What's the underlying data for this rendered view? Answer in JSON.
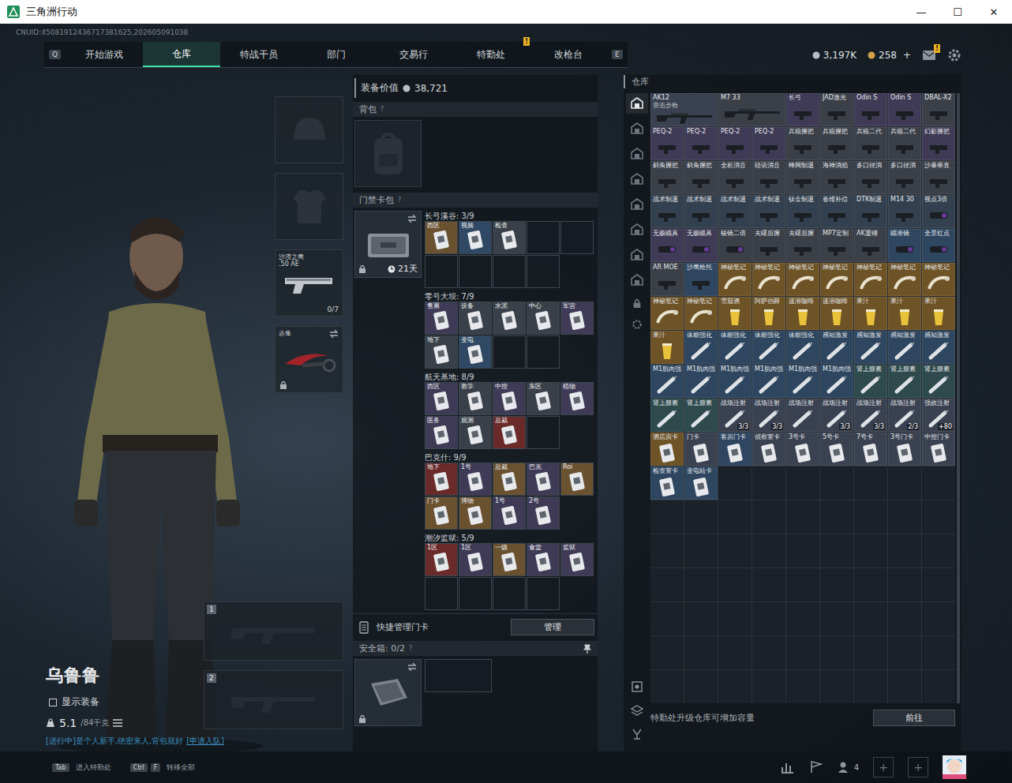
{
  "window": {
    "title": "三角洲行动",
    "controls": [
      "—",
      "☐",
      "✕"
    ]
  },
  "uid": "CNUID:45081912436717381625,202605091038",
  "nav": {
    "left_key": "Q",
    "right_key": "E",
    "tabs": [
      {
        "label": "开始游戏",
        "selected": false
      },
      {
        "label": "仓库",
        "selected": true
      },
      {
        "label": "特战干员",
        "selected": false
      },
      {
        "label": "部门",
        "selected": false
      },
      {
        "label": "交易行",
        "selected": false
      },
      {
        "label": "特勤处",
        "selected": false,
        "badge": "!"
      },
      {
        "label": "改枪台",
        "selected": false
      }
    ]
  },
  "currency": {
    "coins": "3,197K",
    "tokens": "258",
    "add": "+"
  },
  "mail": {
    "badge": "!"
  },
  "character": {
    "name": "乌鲁鲁",
    "show_gear": {
      "label": "显示装备",
      "checked": false
    },
    "weight": "5.1",
    "weight_max": "/84千克",
    "status": "[进行中]是个人新手,绝密来人,背包就好",
    "join": "[申请入队]"
  },
  "equipment": {
    "pistol": {
      "name": "沙漠之鹰",
      "caliber": ".50 AE",
      "ammo": "0/7"
    },
    "knife": {
      "name": "赤隼",
      "locked": true
    }
  },
  "weapons": [
    {
      "number": "1"
    },
    {
      "number": "2"
    }
  ],
  "loadout": {
    "value_label": "装备价值",
    "value": "38,721",
    "backpack": {
      "label": "背包",
      "help": "?"
    },
    "keycase": {
      "label": "门禁卡包",
      "help": "?",
      "days": "21天",
      "locked": true
    },
    "sections": [
      {
        "title": "长弓溪谷: 3/9",
        "cards": [
          {
            "label": "西区",
            "color": "#6a5230"
          },
          {
            "label": "视频",
            "color": "#2f4863"
          },
          {
            "label": "检查",
            "color": "#3a4049"
          }
        ]
      },
      {
        "title": "零号大坝: 7/9",
        "cards": [
          {
            "label": "售票",
            "color": "#3f3a55"
          },
          {
            "label": "设备",
            "color": "#3a4049"
          },
          {
            "label": "水泥",
            "color": "#3a4049"
          },
          {
            "label": "中心",
            "color": "#3a4049"
          },
          {
            "label": "军营",
            "color": "#3f3a55"
          },
          {
            "label": "地下",
            "color": "#3a4049"
          },
          {
            "label": "变电",
            "color": "#2f4863"
          }
        ]
      },
      {
        "title": "航天基地: 8/9",
        "cards": [
          {
            "label": "西区",
            "color": "#3f3a55"
          },
          {
            "label": "教学",
            "color": "#3a4049"
          },
          {
            "label": "中控",
            "color": "#3f3a55"
          },
          {
            "label": "东区",
            "color": "#3a4049"
          },
          {
            "label": "植物",
            "color": "#3f3a55"
          },
          {
            "label": "医务",
            "color": "#3f3a55"
          },
          {
            "label": "观测",
            "color": "#3a4049"
          },
          {
            "label": "总裁",
            "color": "#6a2a2a"
          }
        ]
      },
      {
        "title": "巴克什: 9/9",
        "cards": [
          {
            "label": "地下",
            "color": "#6a2a2a"
          },
          {
            "label": "1号",
            "color": "#3f3a55"
          },
          {
            "label": "总裁",
            "color": "#6a5230"
          },
          {
            "label": "巴克",
            "color": "#3f3a55"
          },
          {
            "label": "Roi",
            "color": "#6a5230"
          },
          {
            "label": "门卡",
            "color": "#6a5230"
          },
          {
            "label": "博物",
            "color": "#6a5230"
          },
          {
            "label": "1号",
            "color": "#3f3a55"
          },
          {
            "label": "2号",
            "color": "#3f3a55"
          }
        ]
      },
      {
        "title": "潮汐监狱: 5/9",
        "cards": [
          {
            "label": "1区",
            "color": "#6a2a2a"
          },
          {
            "label": "1区",
            "color": "#3f3a55"
          },
          {
            "label": "一级",
            "color": "#6a5230"
          },
          {
            "label": "食堂",
            "color": "#3f3a55"
          },
          {
            "label": "监狱",
            "color": "#3f3a55"
          }
        ]
      }
    ],
    "quick": {
      "label": "快捷管理门卡",
      "button": "管理"
    },
    "safebox": {
      "label": "安全箱: 0/2",
      "help": "?",
      "locked": true
    }
  },
  "warehouse": {
    "title": "仓库",
    "sidebar": [
      {
        "selected": true
      },
      {
        "selected": false
      },
      {
        "selected": false
      },
      {
        "selected": false
      },
      {
        "selected": false
      },
      {
        "selected": false
      },
      {
        "selected": false
      },
      {
        "selected": false
      }
    ],
    "items": [
      {
        "label": "AK12",
        "sub": "突击步枪",
        "kind": "rifle",
        "color": "#3a4150"
      },
      {
        "label": "M7 33",
        "kind": "rifle",
        "color": "#3a3f48"
      },
      {
        "label": "长弓",
        "kind": "attachment",
        "color": "#3f3a55"
      },
      {
        "label": "JAD激光",
        "kind": "attachment",
        "color": "#3a3f48"
      },
      {
        "label": "Odin S",
        "kind": "attachment",
        "color": "#3f3a55"
      },
      {
        "label": "Odin S",
        "kind": "attachment",
        "color": "#3f3a55"
      },
      {
        "label": "DBAL-X2",
        "kind": "attachment",
        "color": "#3a3f48"
      },
      {
        "label": "PEQ-2",
        "kind": "attachment",
        "color": "#3f3a55"
      },
      {
        "label": "PEQ-2",
        "kind": "attachment",
        "color": "#3f3a55"
      },
      {
        "label": "PEQ-2",
        "kind": "attachment",
        "color": "#3f3a55"
      },
      {
        "label": "PEQ-2",
        "kind": "attachment",
        "color": "#3f3a55"
      },
      {
        "label": "兵狼握把",
        "kind": "attachment",
        "color": "#3a3f48"
      },
      {
        "label": "兵狼握把",
        "kind": "attachment",
        "color": "#3a3f48"
      },
      {
        "label": "兵狼二代",
        "kind": "attachment",
        "color": "#3a3f48"
      },
      {
        "label": "兵狼二代",
        "kind": "attachment",
        "color": "#3a3f48"
      },
      {
        "label": "幻影握把",
        "kind": "attachment",
        "color": "#3f3a55"
      },
      {
        "label": "斜角握把",
        "kind": "attachment",
        "color": "#3a3f48"
      },
      {
        "label": "斜角握把",
        "kind": "attachment",
        "color": "#3a3f48"
      },
      {
        "label": "全析消音",
        "kind": "attachment",
        "color": "#3a3f48"
      },
      {
        "label": "轻语消音",
        "kind": "attachment",
        "color": "#3a3f48"
      },
      {
        "label": "蜂网制退",
        "kind": "attachment",
        "color": "#3a3f48"
      },
      {
        "label": "海神消焰",
        "kind": "attachment",
        "color": "#3a3f48"
      },
      {
        "label": "多口径消",
        "kind": "attachment",
        "color": "#3a3f48"
      },
      {
        "label": "多口径消",
        "kind": "attachment",
        "color": "#3a3f48"
      },
      {
        "label": "沙暴垂直",
        "kind": "attachment",
        "color": "#3a3f48"
      },
      {
        "label": "战术制退",
        "kind": "attachment",
        "color": "#33404f"
      },
      {
        "label": "战术制退",
        "kind": "attachment",
        "color": "#33404f"
      },
      {
        "label": "战术制退",
        "kind": "attachment",
        "color": "#33404f"
      },
      {
        "label": "战术制退",
        "kind": "attachment",
        "color": "#33404f"
      },
      {
        "label": "钛金制退",
        "kind": "attachment",
        "color": "#33404f"
      },
      {
        "label": "春维补偿",
        "kind": "attachment",
        "color": "#33404f"
      },
      {
        "label": "DTK制退",
        "kind": "attachment",
        "color": "#33404f"
      },
      {
        "label": "M14 30",
        "kind": "attachment",
        "color": "#33404f"
      },
      {
        "label": "视点3倍",
        "kind": "scope",
        "color": "#33404f"
      },
      {
        "label": "无极瞄具",
        "kind": "scope",
        "color": "#3f3a55"
      },
      {
        "label": "无极瞄具",
        "kind": "scope",
        "color": "#3f3a55"
      },
      {
        "label": "棱镜二倍",
        "kind": "scope",
        "color": "#3a3f48"
      },
      {
        "label": "夫曙后握",
        "kind": "attachment",
        "color": "#3a3f48"
      },
      {
        "label": "夫曙后握",
        "kind": "attachment",
        "color": "#3a3f48"
      },
      {
        "label": "MP7定制",
        "kind": "attachment",
        "color": "#3a3f48"
      },
      {
        "label": "AK重锤",
        "kind": "attachment",
        "color": "#3a3f48"
      },
      {
        "label": "瞄准镜",
        "kind": "scope",
        "color": "#2e4660"
      },
      {
        "label": "全景红点",
        "kind": "scope",
        "color": "#2e4660"
      },
      {
        "label": "AR MOE",
        "kind": "attachment",
        "color": "#3a3f48"
      },
      {
        "label": "沙鹰枪托",
        "kind": "attachment",
        "color": "#2e4660"
      },
      {
        "label": "神秘笔记",
        "kind": "note",
        "color": "#6e5326"
      },
      {
        "label": "神秘笔记",
        "kind": "note",
        "color": "#6e5326"
      },
      {
        "label": "神秘笔记",
        "kind": "note",
        "color": "#6e5326"
      },
      {
        "label": "神秘笔记",
        "kind": "note",
        "color": "#6e5326"
      },
      {
        "label": "神秘笔记",
        "kind": "note",
        "color": "#6e5326"
      },
      {
        "label": "神秘笔记",
        "kind": "note",
        "color": "#6e5326"
      },
      {
        "label": "神秘笔记",
        "kind": "note",
        "color": "#6e5326"
      },
      {
        "label": "神秘笔记",
        "kind": "note",
        "color": "#6e5326"
      },
      {
        "label": "神秘笔记",
        "kind": "note",
        "color": "#6e5326"
      },
      {
        "label": "雪茄酒",
        "kind": "drink",
        "color": "#6e5326"
      },
      {
        "label": "阿萨伯爵",
        "kind": "drink",
        "color": "#6e5326"
      },
      {
        "label": "速溶咖啡",
        "kind": "drink",
        "color": "#6e5326"
      },
      {
        "label": "速溶咖啡",
        "kind": "drink",
        "color": "#6e5326"
      },
      {
        "label": "果汁",
        "kind": "drink",
        "color": "#6e5326"
      },
      {
        "label": "果汁",
        "kind": "drink",
        "color": "#6e5326"
      },
      {
        "label": "果汁",
        "kind": "drink",
        "color": "#6e5326"
      },
      {
        "label": "果汁",
        "kind": "drink",
        "color": "#6e5326"
      },
      {
        "label": "体能强化",
        "kind": "syringe",
        "color": "#2e4660"
      },
      {
        "label": "体能强化",
        "kind": "syringe",
        "color": "#2e4660"
      },
      {
        "label": "体能强化",
        "kind": "syringe",
        "color": "#2e4660"
      },
      {
        "label": "体能强化",
        "kind": "syringe",
        "color": "#2e4660"
      },
      {
        "label": "感知激发",
        "kind": "syringe",
        "color": "#2e4660"
      },
      {
        "label": "感知激发",
        "kind": "syringe",
        "color": "#2e4660"
      },
      {
        "label": "感知激发",
        "kind": "syringe",
        "color": "#2e4660"
      },
      {
        "label": "感知激发",
        "kind": "syringe",
        "color": "#2e4660"
      },
      {
        "label": "M1肌肉强",
        "kind": "syringe",
        "color": "#2e4660"
      },
      {
        "label": "M1肌肉强",
        "kind": "syringe",
        "color": "#2e4660"
      },
      {
        "label": "M1肌肉强",
        "kind": "syringe",
        "color": "#2e4660"
      },
      {
        "label": "M1肌肉强",
        "kind": "syringe",
        "color": "#2e4660"
      },
      {
        "label": "M1肌肉强",
        "kind": "syringe",
        "color": "#2e4660"
      },
      {
        "label": "M1肌肉强",
        "kind": "syringe",
        "color": "#2e4660"
      },
      {
        "label": "肾上腺素",
        "kind": "syringe",
        "color": "#2e4a4c"
      },
      {
        "label": "肾上腺素",
        "kind": "syringe",
        "color": "#2e4a4c"
      },
      {
        "label": "肾上腺素",
        "kind": "syringe",
        "color": "#2e4a4c"
      },
      {
        "label": "肾上腺素",
        "kind": "syringe",
        "color": "#2e4a4c"
      },
      {
        "label": "肾上腺素",
        "kind": "syringe",
        "color": "#2e4a4c"
      },
      {
        "label": "战场注射",
        "kind": "syringe",
        "color": "#3a4150",
        "count": "3/3"
      },
      {
        "label": "战场注射",
        "kind": "syringe",
        "color": "#3a4150",
        "count": "3/3"
      },
      {
        "label": "战场注射",
        "kind": "syringe",
        "color": "#3a4150"
      },
      {
        "label": "战场注射",
        "kind": "syringe",
        "color": "#3a4150",
        "count": "3/3"
      },
      {
        "label": "战场注射",
        "kind": "syringe",
        "color": "#3a4150",
        "count": "3/3"
      },
      {
        "label": "战场注射",
        "kind": "syringe",
        "color": "#3a4150",
        "count": "2/3"
      },
      {
        "label": "强效注射",
        "kind": "syringe",
        "color": "#3a4150",
        "count": "+80"
      },
      {
        "label": "酒店房卡",
        "kind": "card",
        "color": "#6e5326"
      },
      {
        "label": "门卡",
        "kind": "card",
        "color": "#3a4150"
      },
      {
        "label": "客房门卡",
        "kind": "card",
        "color": "#2e4660"
      },
      {
        "label": "侦察室卡",
        "kind": "card",
        "color": "#3a4150"
      },
      {
        "label": "3号卡",
        "kind": "card",
        "color": "#3a4150"
      },
      {
        "label": "5号卡",
        "kind": "card",
        "color": "#3a4150"
      },
      {
        "label": "7号卡",
        "kind": "card",
        "color": "#3a4150"
      },
      {
        "label": "3号门卡",
        "kind": "card",
        "color": "#3a4150"
      },
      {
        "label": "中控门卡",
        "kind": "card",
        "color": "#3a4150"
      },
      {
        "label": "检查室卡",
        "kind": "card",
        "color": "#2e4660"
      },
      {
        "label": "变电站卡",
        "kind": "card",
        "color": "#2e4660"
      }
    ],
    "notice": "特勤处升级仓库可增加容量",
    "button": "前往"
  },
  "footer": {
    "hints": [
      {
        "keys": [
          "Tab"
        ],
        "label": "进入特勤处"
      },
      {
        "keys": [
          "Ctrl",
          "F"
        ],
        "label": "转移全部"
      }
    ],
    "friends": "4",
    "plus": [
      "+",
      "+"
    ]
  }
}
